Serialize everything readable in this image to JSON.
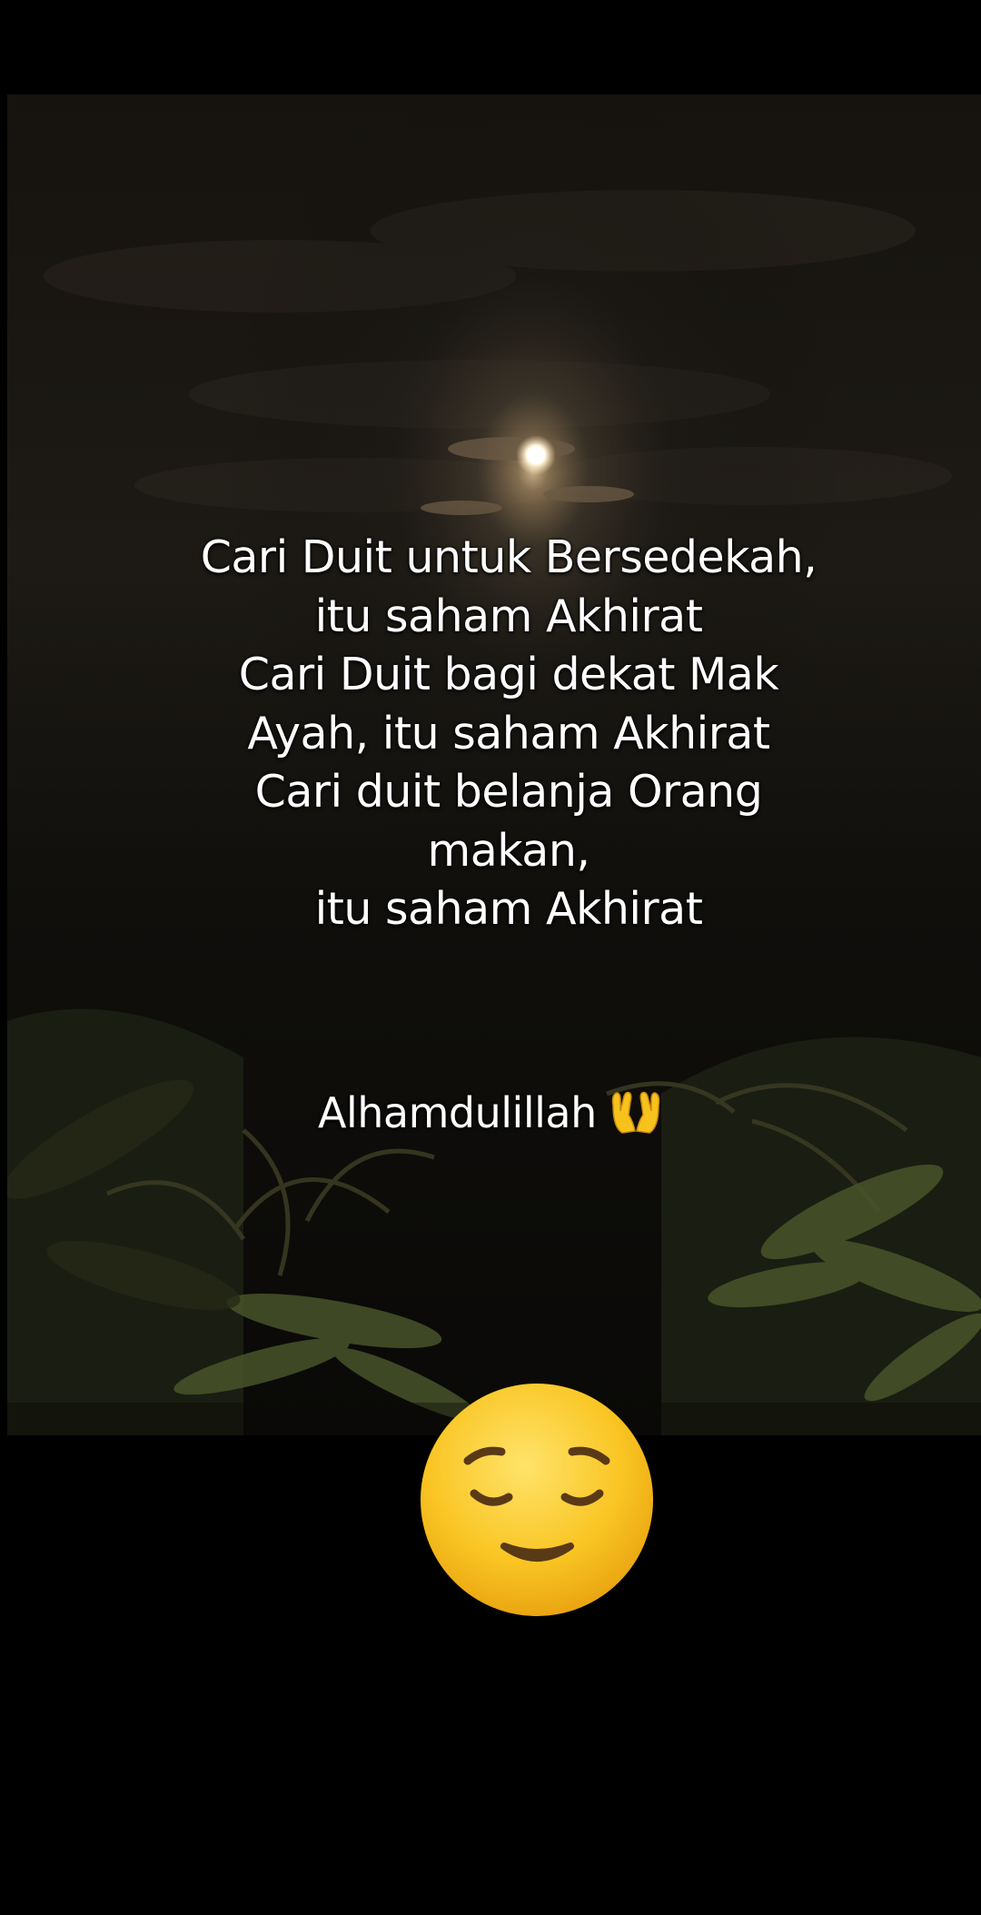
{
  "quote": {
    "lines": [
      "Cari Duit untuk Bersedekah,",
      "itu saham Akhirat",
      "Cari Duit bagi dekat Mak",
      "Ayah, itu saham Akhirat",
      "Cari duit belanja Orang",
      "makan,",
      "itu saham Akhirat"
    ]
  },
  "closing": {
    "text": "Alhamdulillah",
    "emoji": "palms-up-together-icon"
  },
  "sticker": {
    "emoji": "relieved-face-icon"
  },
  "colors": {
    "background": "#000000",
    "text": "#ffffff",
    "moon_glow": "#f3d9a6",
    "emoji_yellow": "#f7c21c"
  }
}
